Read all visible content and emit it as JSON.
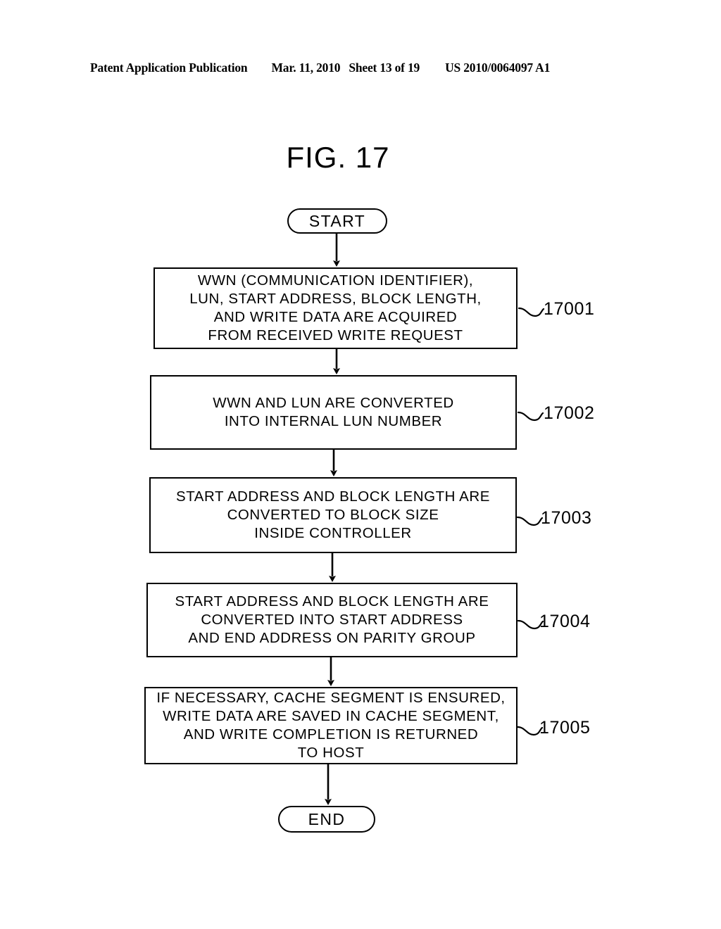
{
  "header": {
    "publication": "Patent Application Publication",
    "date": "Mar. 11, 2010",
    "sheet": "Sheet 13 of 19",
    "doc_number": "US 2010/0064097 A1"
  },
  "figure": {
    "title": "FIG. 17"
  },
  "flowchart": {
    "type": "flowchart",
    "orientation": "top-to-bottom",
    "start": {
      "label": "START",
      "shape": "terminator"
    },
    "end": {
      "label": "END",
      "shape": "terminator"
    },
    "steps": [
      {
        "ref": "17001",
        "shape": "process",
        "lines": [
          "WWN (COMMUNICATION IDENTIFIER),",
          "LUN, START ADDRESS, BLOCK LENGTH,",
          "AND WRITE DATA ARE ACQUIRED",
          "FROM RECEIVED WRITE REQUEST"
        ]
      },
      {
        "ref": "17002",
        "shape": "process",
        "lines": [
          "WWN AND LUN ARE CONVERTED",
          "INTO INTERNAL LUN NUMBER"
        ]
      },
      {
        "ref": "17003",
        "shape": "process",
        "lines": [
          "START ADDRESS AND BLOCK LENGTH ARE",
          "CONVERTED TO BLOCK SIZE",
          "INSIDE CONTROLLER"
        ]
      },
      {
        "ref": "17004",
        "shape": "process",
        "lines": [
          "START ADDRESS AND BLOCK LENGTH ARE",
          "CONVERTED INTO START ADDRESS",
          "AND END ADDRESS ON PARITY GROUP"
        ]
      },
      {
        "ref": "17005",
        "shape": "process",
        "lines": [
          "IF NECESSARY, CACHE SEGMENT IS ENSURED,",
          "WRITE DATA ARE SAVED IN CACHE SEGMENT,",
          "AND WRITE COMPLETION IS RETURNED",
          "TO HOST"
        ]
      }
    ],
    "connectors": [
      {
        "from": "START",
        "to": "17001",
        "style": "arrow"
      },
      {
        "from": "17001",
        "to": "17002",
        "style": "arrow"
      },
      {
        "from": "17002",
        "to": "17003",
        "style": "arrow"
      },
      {
        "from": "17003",
        "to": "17004",
        "style": "arrow"
      },
      {
        "from": "17004",
        "to": "17005",
        "style": "arrow"
      },
      {
        "from": "17005",
        "to": "END",
        "style": "arrow"
      }
    ]
  },
  "colors": {
    "ink": "#000000",
    "paper": "#ffffff"
  }
}
